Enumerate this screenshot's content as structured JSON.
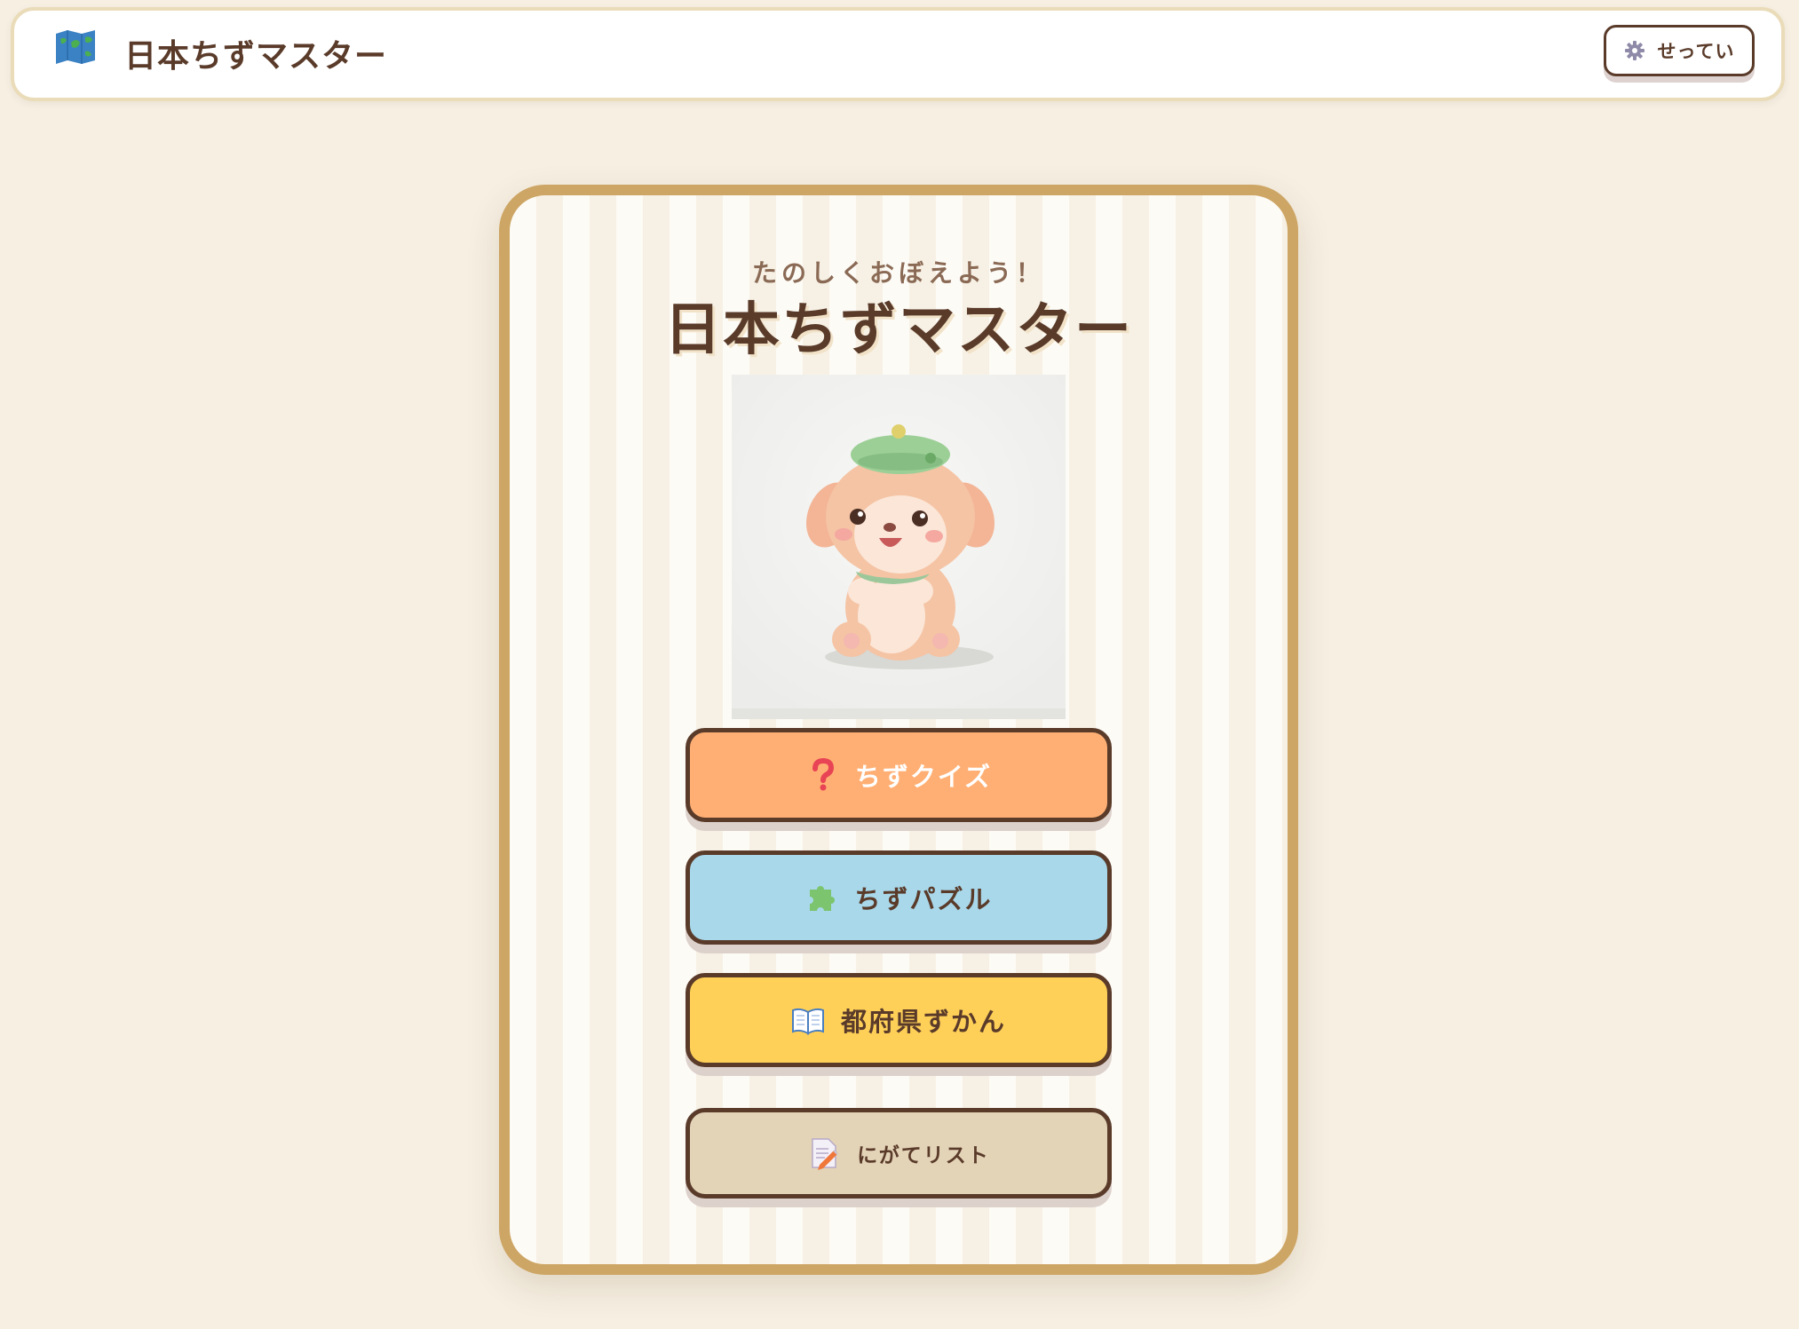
{
  "header": {
    "title": "日本ちずマスター",
    "logo_icon": "map-icon",
    "settings_label": "せってい",
    "settings_icon": "gear-icon"
  },
  "card": {
    "subtitle": "たのしくおぼえよう！",
    "title": "日本ちずマスター",
    "mascot": "puppy-mascot-image"
  },
  "menu": {
    "quiz": {
      "label": "ちずクイズ",
      "icon": "question-mark-icon",
      "color": "#ffaf73"
    },
    "puzzle": {
      "label": "ちずパズル",
      "icon": "puzzle-piece-icon",
      "color": "#a8d8ea"
    },
    "zukan": {
      "label": "都府県ずかん",
      "icon": "open-book-icon",
      "color": "#ffd058"
    },
    "nigate": {
      "label": "にがてリスト",
      "icon": "memo-pencil-icon",
      "color": "#e3d3b7"
    }
  },
  "colors": {
    "background": "#f6efe2",
    "text": "#5a3b2a",
    "card_border": "#cda564"
  }
}
